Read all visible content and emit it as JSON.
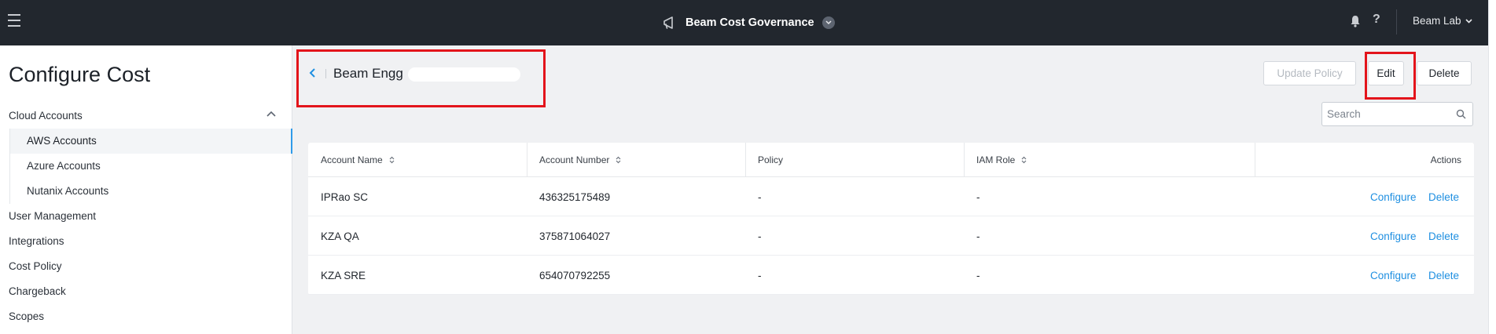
{
  "header": {
    "app_title": "Beam Cost Governance",
    "account_label": "Beam Lab",
    "help_glyph": "?"
  },
  "sidebar": {
    "title": "Configure Cost",
    "sections": {
      "cloud_accounts": "Cloud Accounts",
      "sub_items": [
        "AWS Accounts",
        "Azure Accounts",
        "Nutanix Accounts"
      ],
      "user_management": "User Management",
      "integrations": "Integrations",
      "cost_policy": "Cost Policy",
      "chargeback": "Chargeback",
      "scopes": "Scopes"
    },
    "active_item": "AWS Accounts"
  },
  "main": {
    "policy_name": "Beam Engg",
    "buttons": {
      "update_policy": "Update Policy",
      "edit": "Edit",
      "delete": "Delete"
    },
    "search": {
      "placeholder": "Search",
      "value": ""
    },
    "table": {
      "columns": [
        "Account Name",
        "Account Number",
        "Policy",
        "IAM Role",
        "Actions"
      ],
      "rows": [
        {
          "account_name": "IPRao SC",
          "account_number": "436325175489",
          "policy": "-",
          "iam_role": "-",
          "actions": [
            "Configure",
            "Delete"
          ]
        },
        {
          "account_name": "KZA QA",
          "account_number": "375871064027",
          "policy": "-",
          "iam_role": "-",
          "actions": [
            "Configure",
            "Delete"
          ]
        },
        {
          "account_name": "KZA SRE",
          "account_number": "654070792255",
          "policy": "-",
          "iam_role": "-",
          "actions": [
            "Configure",
            "Delete"
          ]
        }
      ]
    }
  },
  "colors": {
    "topbar": "#22272e",
    "accent": "#1e8fe1",
    "highlight": "#e3141b"
  },
  "icons": [
    "hamburger-icon",
    "megaphone-icon",
    "chevron-down-icon",
    "bell-icon",
    "help-icon",
    "chevron-up-icon",
    "chevron-left-icon",
    "search-icon",
    "sort-icon"
  ]
}
